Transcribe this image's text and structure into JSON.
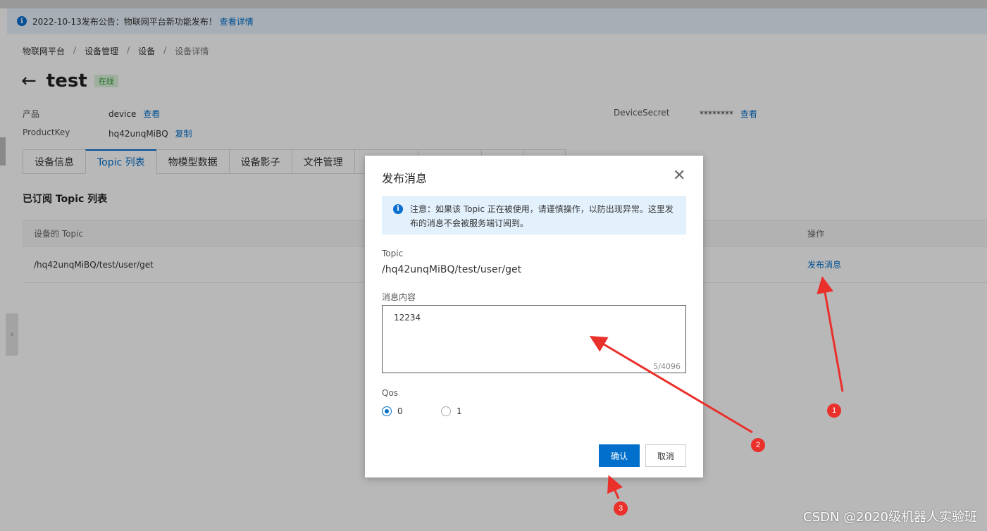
{
  "notice": {
    "text": "2022-10-13发布公告：物联网平台新功能发布！",
    "link": "查看详情"
  },
  "breadcrumb": [
    "物联网平台",
    "设备管理",
    "设备",
    "设备详情"
  ],
  "device": {
    "name": "test",
    "status": "在线"
  },
  "meta": {
    "product_label": "产品",
    "product_value": "device",
    "product_link": "查看",
    "productkey_label": "ProductKey",
    "productkey_value": "hq42unqMiBQ",
    "productkey_link": "复制",
    "secret_label": "DeviceSecret",
    "secret_value": "********",
    "secret_link": "查看"
  },
  "tabs": [
    "设备信息",
    "Topic 列表",
    "物模型数据",
    "设备影子",
    "文件管理"
  ],
  "section_title": "已订阅 Topic 列表",
  "table": {
    "col_topic": "设备的 Topic",
    "col_action": "操作",
    "rows": [
      {
        "topic": "/hq42unqMiBQ/test/user/get",
        "action": "发布消息"
      }
    ]
  },
  "modal": {
    "title": "发布消息",
    "alert": "注意：如果该 Topic 正在被使用，请谨慎操作，以防出现异常。这里发布的消息不会被服务端订阅到。",
    "topic_label": "Topic",
    "topic_value": "/hq42unqMiBQ/test/user/get",
    "content_label": "消息内容",
    "content_value": "12234",
    "counter": "5/4096",
    "qos_label": "Qos",
    "qos_options": [
      "0",
      "1"
    ],
    "confirm": "确认",
    "cancel": "取消"
  },
  "annotations": [
    "1",
    "2",
    "3"
  ],
  "watermark": "CSDN @2020级机器人实验班",
  "colors": {
    "accent": "#0070cc",
    "annotation": "#e9302b"
  }
}
